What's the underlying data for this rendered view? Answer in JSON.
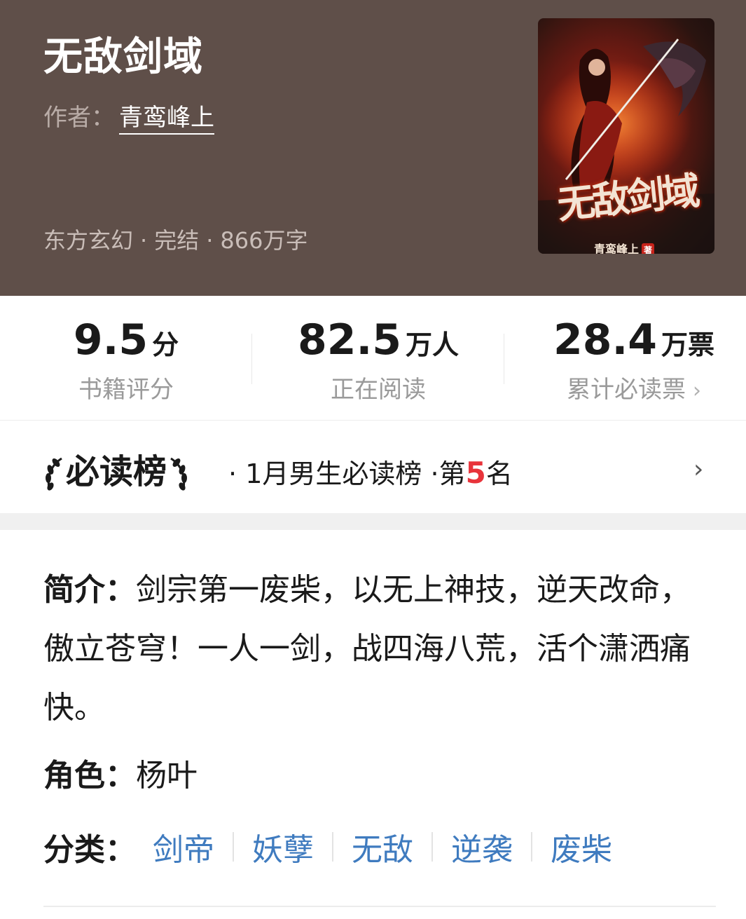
{
  "book": {
    "title": "无敌剑域",
    "author_label": "作者：",
    "author": "青鸾峰上",
    "category": "东方玄幻",
    "status": "完结",
    "word_count": "866万字",
    "meta_separator": "·"
  },
  "cover": {
    "title": "无敌剑域",
    "author": "青鸾峰上",
    "author_badge": "著"
  },
  "stats": [
    {
      "value": "9.5",
      "unit": "分",
      "label": "书籍评分"
    },
    {
      "value": "82.5",
      "unit": "万人",
      "label": "正在阅读"
    },
    {
      "value": "28.4",
      "unit": "万票",
      "label": "累计必读票",
      "chevron": "›"
    }
  ],
  "ranking": {
    "badge": "必读榜",
    "separator": "·",
    "list": "1月男生必读榜",
    "rank_prefix": "第",
    "rank": "5",
    "rank_suffix": "名",
    "chevron": "›"
  },
  "details": {
    "intro_label": "简介：",
    "intro": "剑宗第一废柴，以无上神技，逆天改命，傲立苍穹！一人一剑，战四海八荒，活个潇洒痛快。",
    "role_label": "角色：",
    "role": "杨叶",
    "tags_label": "分类：",
    "tags": [
      "剑帝",
      "妖孽",
      "无敌",
      "逆袭",
      "废柴"
    ]
  },
  "colors": {
    "header_bg": "#5f4f49",
    "tag": "#3f7bbf",
    "rank_highlight": "#e8343b"
  }
}
